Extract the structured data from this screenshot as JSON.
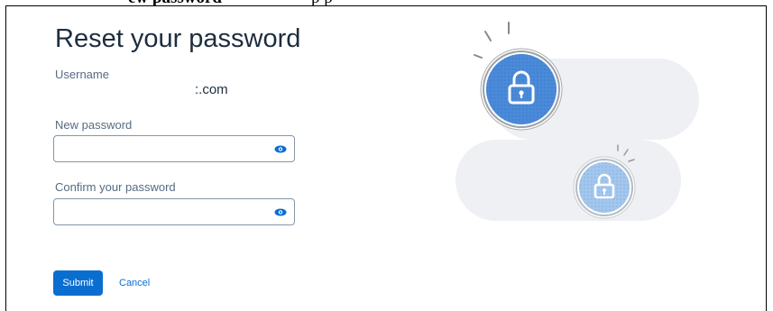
{
  "document_heading": {
    "part1": "ew password",
    "part2": "p    p"
  },
  "form": {
    "title": "Reset your password",
    "username_label": "Username",
    "username_value": ":.com",
    "new_password_label": "New password",
    "new_password_value": "",
    "confirm_password_label": "Confirm your password",
    "confirm_password_value": "",
    "submit_label": "Submit",
    "cancel_label": "Cancel"
  },
  "icons": {
    "password_visibility": "eye-icon",
    "illustration": "lock-icon"
  },
  "colors": {
    "primary": "#0a6ed1",
    "heading": "#1d2d3e",
    "label": "#556b82",
    "illustration_bg": "#eef0f3"
  }
}
